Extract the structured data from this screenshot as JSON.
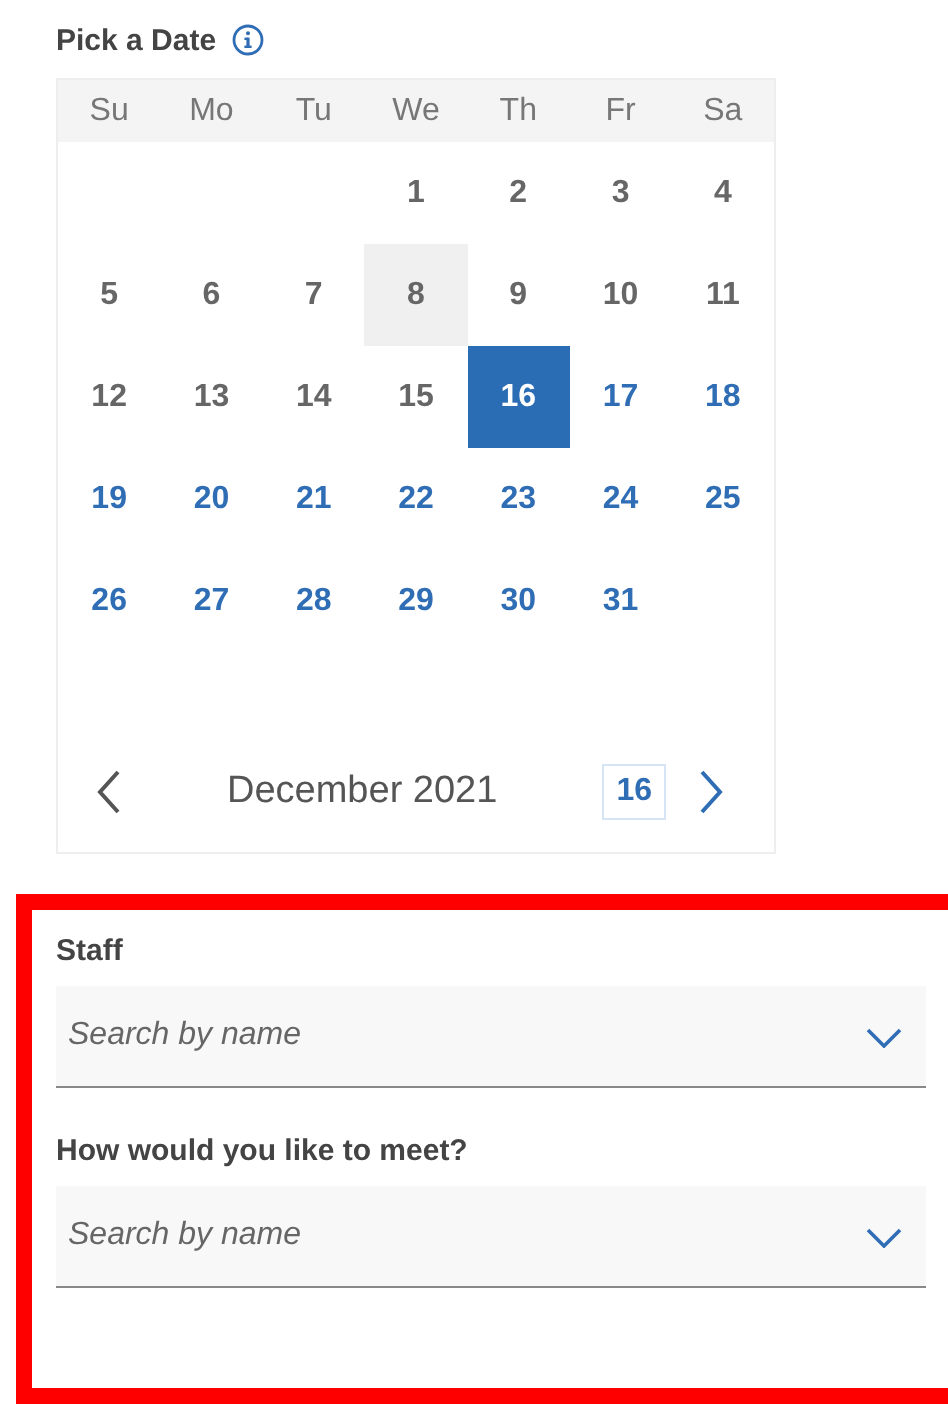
{
  "calendar": {
    "title": "Pick a Date",
    "weekdays": [
      "Su",
      "Mo",
      "Tu",
      "We",
      "Th",
      "Fr",
      "Sa"
    ],
    "weeks": [
      [
        {
          "kind": "blank"
        },
        {
          "kind": "blank"
        },
        {
          "kind": "blank"
        },
        {
          "kind": "unavailable",
          "day": "1",
          "selected": false,
          "today": false
        },
        {
          "kind": "unavailable",
          "day": "2",
          "selected": false,
          "today": false
        },
        {
          "kind": "unavailable",
          "day": "3",
          "selected": false,
          "today": false
        },
        {
          "kind": "unavailable",
          "day": "4",
          "selected": false,
          "today": false
        }
      ],
      [
        {
          "kind": "unavailable",
          "day": "5",
          "selected": false,
          "today": false
        },
        {
          "kind": "unavailable",
          "day": "6",
          "selected": false,
          "today": false
        },
        {
          "kind": "unavailable",
          "day": "7",
          "selected": false,
          "today": false
        },
        {
          "kind": "unavailable",
          "day": "8",
          "selected": false,
          "today": true
        },
        {
          "kind": "unavailable",
          "day": "9",
          "selected": false,
          "today": false
        },
        {
          "kind": "unavailable",
          "day": "10",
          "selected": false,
          "today": false
        },
        {
          "kind": "unavailable",
          "day": "11",
          "selected": false,
          "today": false
        }
      ],
      [
        {
          "kind": "unavailable",
          "day": "12",
          "selected": false,
          "today": false
        },
        {
          "kind": "unavailable",
          "day": "13",
          "selected": false,
          "today": false
        },
        {
          "kind": "unavailable",
          "day": "14",
          "selected": false,
          "today": false
        },
        {
          "kind": "unavailable",
          "day": "15",
          "selected": false,
          "today": false
        },
        {
          "kind": "available",
          "day": "16",
          "selected": true,
          "today": false
        },
        {
          "kind": "available",
          "day": "17",
          "selected": false,
          "today": false
        },
        {
          "kind": "available",
          "day": "18",
          "selected": false,
          "today": false
        }
      ],
      [
        {
          "kind": "available",
          "day": "19",
          "selected": false,
          "today": false
        },
        {
          "kind": "available",
          "day": "20",
          "selected": false,
          "today": false
        },
        {
          "kind": "available",
          "day": "21",
          "selected": false,
          "today": false
        },
        {
          "kind": "available",
          "day": "22",
          "selected": false,
          "today": false
        },
        {
          "kind": "available",
          "day": "23",
          "selected": false,
          "today": false
        },
        {
          "kind": "available",
          "day": "24",
          "selected": false,
          "today": false
        },
        {
          "kind": "available",
          "day": "25",
          "selected": false,
          "today": false
        }
      ],
      [
        {
          "kind": "available",
          "day": "26",
          "selected": false,
          "today": false
        },
        {
          "kind": "available",
          "day": "27",
          "selected": false,
          "today": false
        },
        {
          "kind": "available",
          "day": "28",
          "selected": false,
          "today": false
        },
        {
          "kind": "available",
          "day": "29",
          "selected": false,
          "today": false
        },
        {
          "kind": "available",
          "day": "30",
          "selected": false,
          "today": false
        },
        {
          "kind": "available",
          "day": "31",
          "selected": false,
          "today": false
        },
        {
          "kind": "blank"
        }
      ],
      [
        {
          "kind": "blank"
        },
        {
          "kind": "blank"
        },
        {
          "kind": "blank"
        },
        {
          "kind": "blank"
        },
        {
          "kind": "blank"
        },
        {
          "kind": "blank"
        },
        {
          "kind": "blank"
        }
      ]
    ],
    "month": "December 2021",
    "today_button": "16"
  },
  "fields": [
    {
      "label": "Staff",
      "placeholder": "Search by name"
    },
    {
      "label": "How would you like to meet?",
      "placeholder": "Search by name"
    }
  ]
}
